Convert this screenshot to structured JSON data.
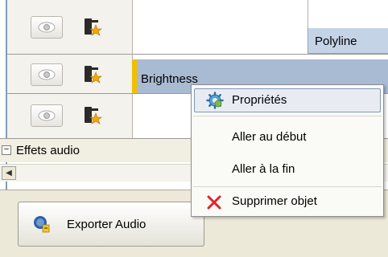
{
  "tracks": {
    "rows": [
      {
        "eye_icon": "eye-icon",
        "fx_icon": "effects-star-icon"
      },
      {
        "eye_icon": "eye-icon",
        "fx_icon": "effects-star-icon"
      },
      {
        "eye_icon": "eye-icon",
        "fx_icon": "effects-star-icon"
      }
    ],
    "clips": {
      "polyline_label": "Polyline",
      "brightness_label": "Brightness"
    },
    "audio_section": {
      "toggle": "−",
      "label": "Effets audio"
    },
    "scroll_left_arrow": "◀"
  },
  "context_menu": {
    "items": [
      {
        "label": "Propriétés",
        "icon": "gear-icon",
        "highlighted": true
      },
      {
        "label": "Aller au début"
      },
      {
        "label": "Aller à la fin"
      },
      {
        "label": "Supprimer objet",
        "icon": "red-x-icon"
      }
    ]
  },
  "bottom": {
    "export_label": "Exporter Audio",
    "export_icon": "audio-export-icon"
  },
  "colors": {
    "clip_highlight": "#a9bad3",
    "clip_marker": "#f0c000",
    "menu_highlight_border": "#7e98bd",
    "delete_red": "#e0242b"
  }
}
